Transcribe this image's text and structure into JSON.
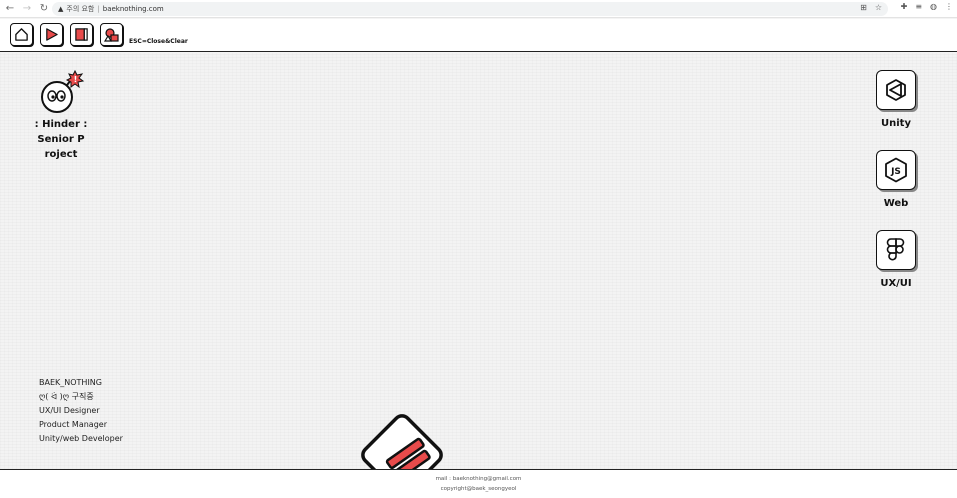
{
  "browser": {
    "security_label": "주의 요함",
    "url": "baeknothing.com"
  },
  "toolbar": {
    "hint": "ESC=Close&Clear",
    "buttons": [
      {
        "icon": "home-icon"
      },
      {
        "icon": "play-icon"
      },
      {
        "icon": "door-icon"
      },
      {
        "icon": "shapes-icon"
      }
    ]
  },
  "desktop": {
    "project": {
      "label_lines": [
        ": Hinder :",
        "Senior P",
        "roject"
      ],
      "icon": "bomb-character-icon",
      "badge": "!",
      "accent": "#e84b4b"
    },
    "apps": [
      {
        "label": "Unity",
        "icon": "unity-icon"
      },
      {
        "label": "Web",
        "icon": "nodejs-icon"
      },
      {
        "label": "UX/UI",
        "icon": "figma-icon"
      }
    ],
    "profile": {
      "lines": [
        "BAEK_NOTHING",
        "ღ( ᐛ )ღ 구직중",
        "UX/UI Designer",
        "Product Manager",
        "Unity/web Developer"
      ]
    },
    "center_logo": {
      "icon": "brand-logo-icon",
      "accent": "#e84b4b"
    }
  },
  "footer": {
    "mail": "mail : baeknothing@gmail.com",
    "copyright": "copyright@baek_seongyeol"
  },
  "colors": {
    "accent": "#e84b4b",
    "ink": "#111111",
    "background": "#f3f3f3"
  }
}
